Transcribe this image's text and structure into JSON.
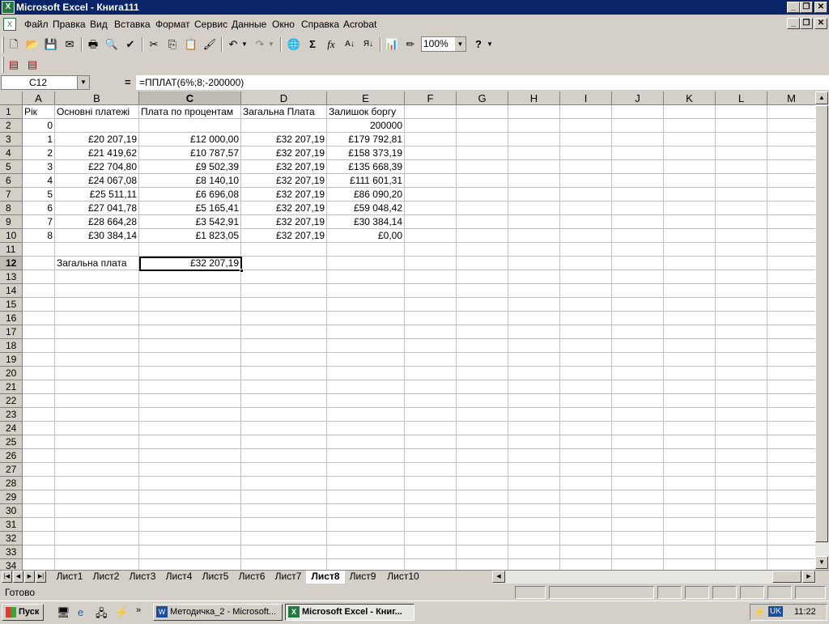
{
  "window": {
    "title": "Microsoft Excel - Книга111"
  },
  "menu": [
    "Файл",
    "Правка",
    "Вид",
    "Вставка",
    "Формат",
    "Сервис",
    "Данные",
    "Окно",
    "Справка",
    "Acrobat"
  ],
  "toolbar": {
    "zoom": "100%",
    "help": "?"
  },
  "formula_bar": {
    "name_box": "C12",
    "eq": "=",
    "formula": "=ППЛАТ(6%;8;-200000)"
  },
  "columns": [
    "A",
    "B",
    "C",
    "D",
    "E",
    "F",
    "G",
    "H",
    "I",
    "J",
    "K",
    "L",
    "M"
  ],
  "selected_column": "C",
  "rows": [
    "1",
    "2",
    "3",
    "4",
    "5",
    "6",
    "7",
    "8",
    "9",
    "10",
    "11",
    "12",
    "13",
    "14",
    "15",
    "16",
    "17",
    "18",
    "19",
    "20",
    "21",
    "22",
    "23",
    "24",
    "25",
    "26",
    "27",
    "28",
    "29",
    "30",
    "31",
    "32",
    "33",
    "34"
  ],
  "selected_row": "12",
  "sheet": {
    "header": {
      "A": "Рік",
      "B": "Основні платежі",
      "C": "Плата по процентам",
      "D": "Загальна Плата",
      "E": "Залишок боргу"
    },
    "data": [
      {
        "A": "0",
        "B": "",
        "C": "",
        "D": "",
        "E": "200000"
      },
      {
        "A": "1",
        "B": "£20 207,19",
        "C": "£12 000,00",
        "D": "£32 207,19",
        "E": "£179 792,81"
      },
      {
        "A": "2",
        "B": "£21 419,62",
        "C": "£10 787,57",
        "D": "£32 207,19",
        "E": "£158 373,19"
      },
      {
        "A": "3",
        "B": "£22 704,80",
        "C": "£9 502,39",
        "D": "£32 207,19",
        "E": "£135 668,39"
      },
      {
        "A": "4",
        "B": "£24 067,08",
        "C": "£8 140,10",
        "D": "£32 207,19",
        "E": "£111 601,31"
      },
      {
        "A": "5",
        "B": "£25 511,11",
        "C": "£6 696,08",
        "D": "£32 207,19",
        "E": "£86 090,20"
      },
      {
        "A": "6",
        "B": "£27 041,78",
        "C": "£5 165,41",
        "D": "£32 207,19",
        "E": "£59 048,42"
      },
      {
        "A": "7",
        "B": "£28 664,28",
        "C": "£3 542,91",
        "D": "£32 207,19",
        "E": "£30 384,14"
      },
      {
        "A": "8",
        "B": "£30 384,14",
        "C": "£1 823,05",
        "D": "£32 207,19",
        "E": "£0,00"
      }
    ],
    "total_label": "Загальна плата",
    "total_value": "£32 207,19"
  },
  "tabs": [
    "Лист1",
    "Лист2",
    "Лист3",
    "Лист4",
    "Лист5",
    "Лист6",
    "Лист7",
    "Лист8",
    "Лист9",
    "Лист10"
  ],
  "active_tab": "Лист8",
  "status": {
    "text": "Готово"
  },
  "taskbar": {
    "start": "Пуск",
    "items": [
      {
        "label": "Методичка_2 - Microsoft...",
        "active": false
      },
      {
        "label": "Microsoft Excel - Книг...",
        "active": true
      }
    ],
    "lang": "UK",
    "clock": "11:22"
  },
  "colors": {
    "titlebar": "#0a246a",
    "chrome": "#d4d0c8",
    "grid": "#c0c0c0"
  }
}
